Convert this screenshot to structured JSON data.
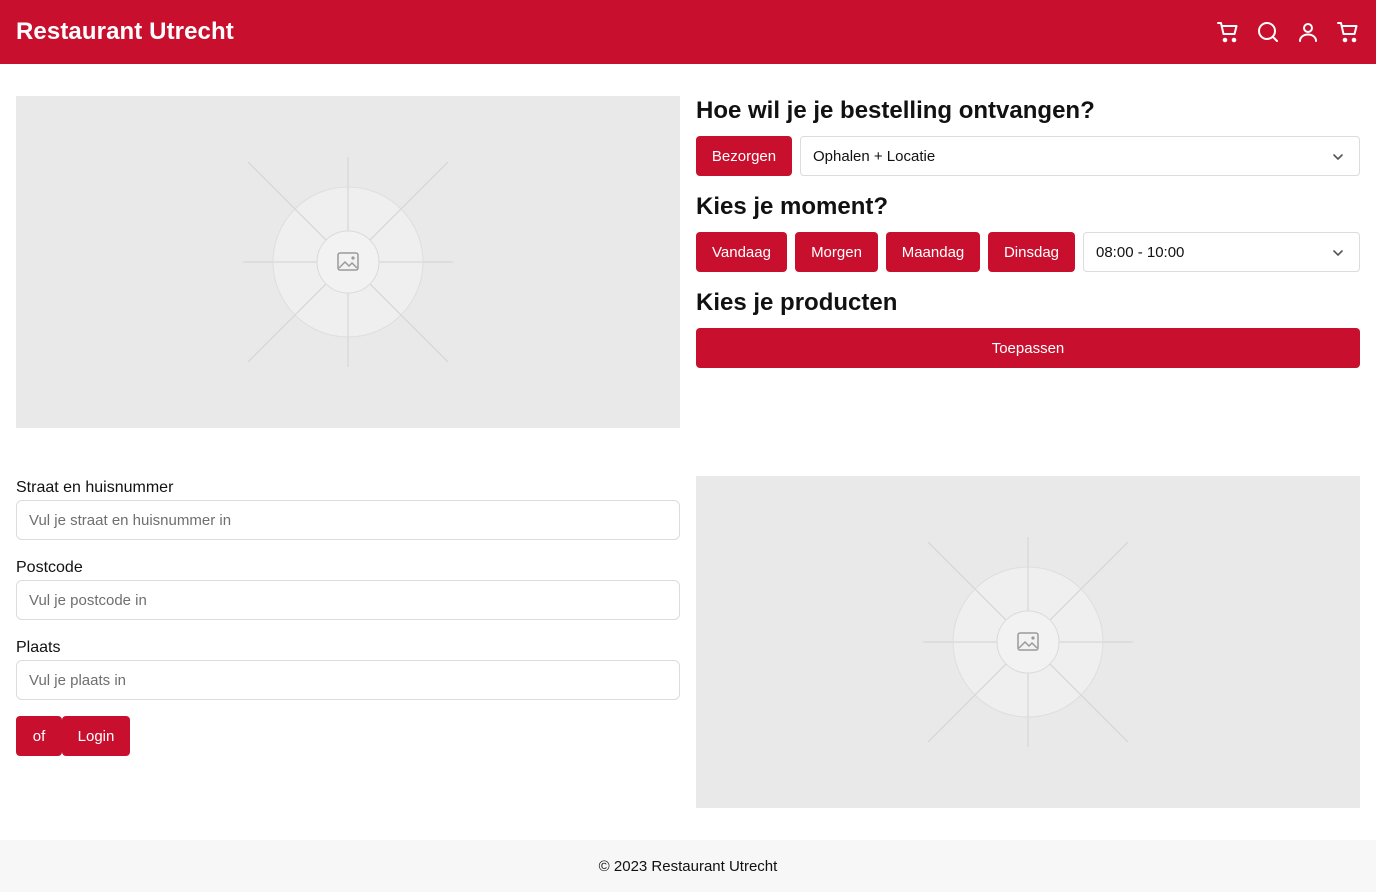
{
  "header": {
    "title": "Restaurant Utrecht",
    "icons": [
      "cart-icon",
      "search-icon",
      "user-icon",
      "cart-icon"
    ]
  },
  "delivery": {
    "heading": "Hoe wil je je bestelling ontvangen?",
    "deliver_label": "Bezorgen",
    "pickup_selected": "Ophalen + Locatie"
  },
  "moment": {
    "heading": "Kies je moment?",
    "days": [
      "Vandaag",
      "Morgen",
      "Maandag",
      "Dinsdag"
    ],
    "timeslot_selected": "08:00 - 10:00"
  },
  "products": {
    "heading": "Kies je producten",
    "apply_label": "Toepassen"
  },
  "address_form": {
    "street_label": "Straat en huisnummer",
    "street_placeholder": "Vul je straat en huisnummer in",
    "postcode_label": "Postcode",
    "postcode_placeholder": "Vul je postcode in",
    "city_label": "Plaats",
    "city_placeholder": "Vul je plaats in",
    "or_label": "of",
    "login_label": "Login"
  },
  "footer": {
    "copyright": "© 2023 Restaurant Utrecht"
  },
  "colors": {
    "brand": "#c8102e",
    "placeholder_bg": "#e9e9e9",
    "footer_bg": "#f7f7f7"
  }
}
